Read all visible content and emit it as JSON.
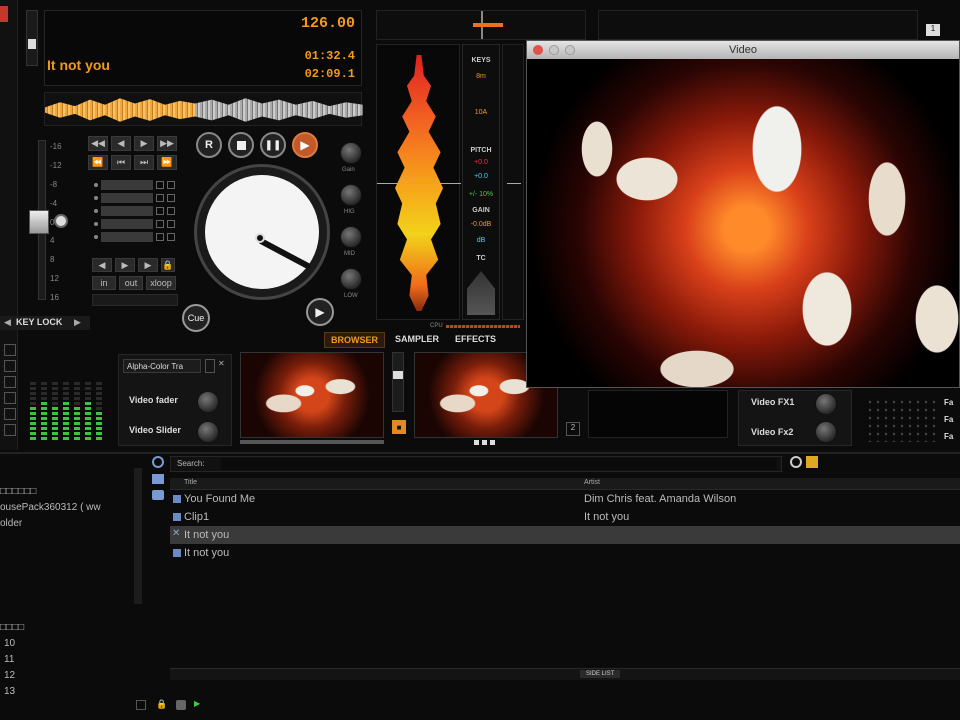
{
  "deck": {
    "bpm": "126.00",
    "track_title": "It not you",
    "time_elapsed": "01:32.4",
    "time_remaining": "02:09.1",
    "pitch_scale": [
      "-16",
      "-12",
      "-8",
      "-4",
      "0",
      "4",
      "8",
      "12",
      "16"
    ],
    "loop_buttons": [
      "in",
      "out",
      "xloop"
    ],
    "knob_labels": [
      "Gain",
      "HIG",
      "MID",
      "LOW"
    ],
    "cue_label": "Cue",
    "key_lock": "KEY LOCK"
  },
  "info_panel": {
    "keys_label": "KEYS",
    "key1": "8m",
    "key2": "10A",
    "pitch_label": "PITCH",
    "pitch1": "+0.0",
    "pitch2": "+0.0",
    "pitch3": "+/- 10%",
    "gain_label": "GAIN",
    "gain_val": "-0.0dB",
    "db": "dB",
    "tc_label": "TC"
  },
  "tabs": [
    {
      "label": "BROWSER",
      "active": true
    },
    {
      "label": "SAMPLER",
      "active": false
    },
    {
      "label": "EFFECTS",
      "active": false
    }
  ],
  "cpu_label": "CPU",
  "video_panel": {
    "transition": "Alpha-Color Tra",
    "fader_label": "Video fader",
    "slider_label": "Video Slider",
    "fx1": "Video FX1",
    "fx2": "Video Fx2",
    "side_labels": [
      "Fa",
      "Fa",
      "Fa"
    ],
    "right_num": "1",
    "mid_num": "2"
  },
  "video_window": {
    "title": "Video"
  },
  "browser": {
    "search_label": "Search:",
    "columns": [
      "Title",
      "Artist"
    ],
    "rows": [
      {
        "title": "You Found Me",
        "artist": "Dim Chris feat. Amanda Wilson",
        "selected": false
      },
      {
        "title": "Clip1",
        "artist": "It not you",
        "selected": false
      },
      {
        "title": "It not you",
        "artist": "",
        "selected": true
      },
      {
        "title": "It not you",
        "artist": "",
        "selected": false
      }
    ],
    "side_list": "SIDE LIST"
  },
  "folders": {
    "items": [
      "□□□□□□",
      "ousePack360312 ( ww",
      "older"
    ],
    "items2": [
      "□□□□",
      "10",
      "11",
      "12",
      "13"
    ]
  }
}
